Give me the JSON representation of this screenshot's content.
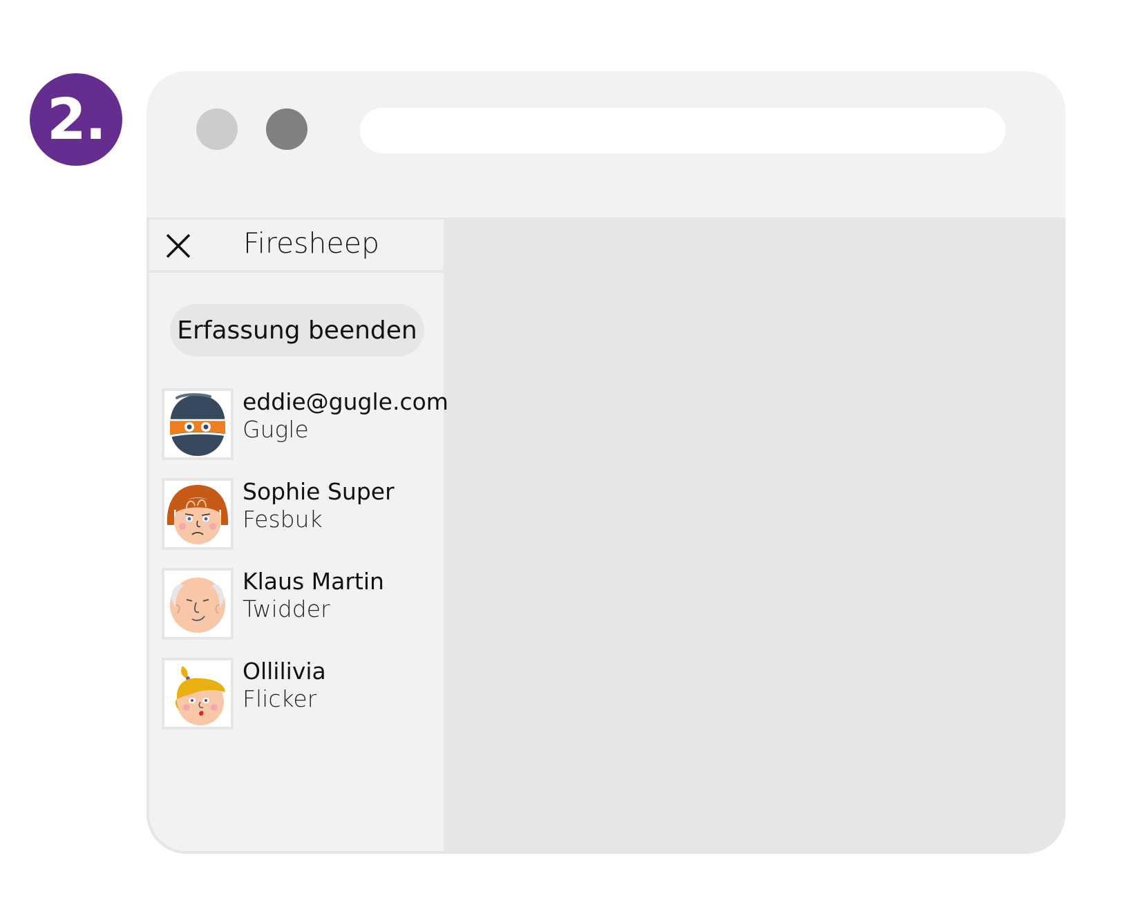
{
  "step": {
    "label": "2."
  },
  "browser": {
    "address_bar_value": ""
  },
  "sidebar": {
    "title": "Firesheep",
    "stop_button_label": "Erfassung beenden",
    "sessions": [
      {
        "name": "eddie@gugle.com",
        "site": "Gugle",
        "avatar": "masked-burglar-avatar"
      },
      {
        "name": "Sophie Super",
        "site": "Fesbuk",
        "avatar": "red-haired-woman-avatar"
      },
      {
        "name": "Klaus Martin",
        "site": "Twidder",
        "avatar": "bald-man-avatar"
      },
      {
        "name": "Ollilivia",
        "site": "Flicker",
        "avatar": "blonde-girl-avatar"
      }
    ]
  },
  "colors": {
    "badge": "#662d91",
    "window": "#f2f2f2",
    "content": "#e6e6e6",
    "dot_light": "#cccccc",
    "dot_dark": "#808080"
  }
}
